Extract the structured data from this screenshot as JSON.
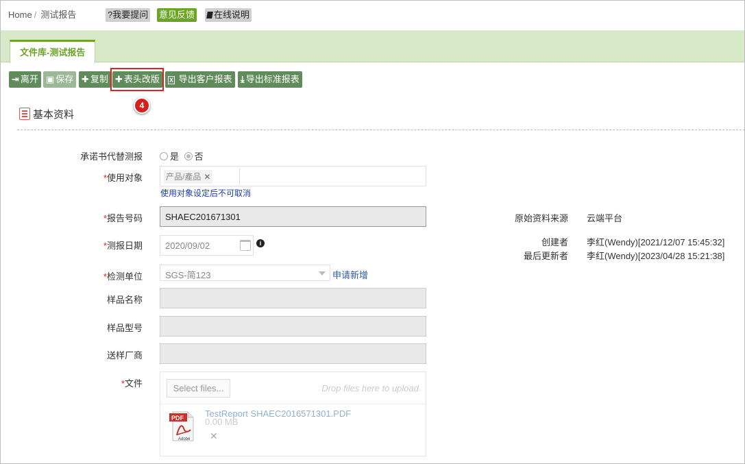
{
  "breadcrumb": {
    "home": "Home",
    "separator": "/",
    "current": "测试报告"
  },
  "topbar": {
    "ask": "?我要提问",
    "feedback": "意见反馈",
    "manual_icon": "book-icon",
    "manual": "在线说明"
  },
  "tab": {
    "label": "文件库-测试报告"
  },
  "toolbar": {
    "leave": "离开",
    "save": "保存",
    "copy": "复制",
    "header_revision": "表头改版",
    "export_customer": "导出客户报表",
    "export_standard": "导出标准报表"
  },
  "annotation": {
    "badge": "4"
  },
  "section": {
    "title": "基本资料"
  },
  "form": {
    "required_mark": "*",
    "pledge_label": "承诺书代替测报",
    "pledge_yes": "是",
    "pledge_no": "否",
    "target_label": "使用对象",
    "target_tag": "产品/產品",
    "target_tag_remove": "✕",
    "target_hint": "使用对象设定后不可取消",
    "report_no_label": "报告号码",
    "report_no": "SHAEC201671301",
    "test_date_label": "测报日期",
    "test_date": "2020/09/02",
    "lab_label": "检测单位",
    "lab_value": "SGS-简123",
    "lab_apply": "申请新增",
    "sample_name_label": "样品名称",
    "sample_model_label": "样品型号",
    "vendor_label": "送样厂商",
    "file_label": "文件"
  },
  "meta": {
    "source_label": "原始资料来源",
    "source_value": "云端平台",
    "creator_label": "创建者",
    "creator_value": "李红(Wendy)[2021/12/07 15:45:32]",
    "updater_label": "最后更新者",
    "updater_value": "李红(Wendy)[2023/04/28 15:21:38]"
  },
  "upload": {
    "select": "Select files...",
    "drop": "Drop files here to upload",
    "file_name": "TestReport  SHAEC2016571301.PDF",
    "file_size": "0.00 MB",
    "remove": "✕",
    "pdf_badge": "PDF",
    "pdf_brand": "Adobe"
  },
  "colors": {
    "accent": "#6aa526",
    "toolbar": "#5f8c5a",
    "tabstrip": "#d7e9c6",
    "required": "#e02020"
  }
}
